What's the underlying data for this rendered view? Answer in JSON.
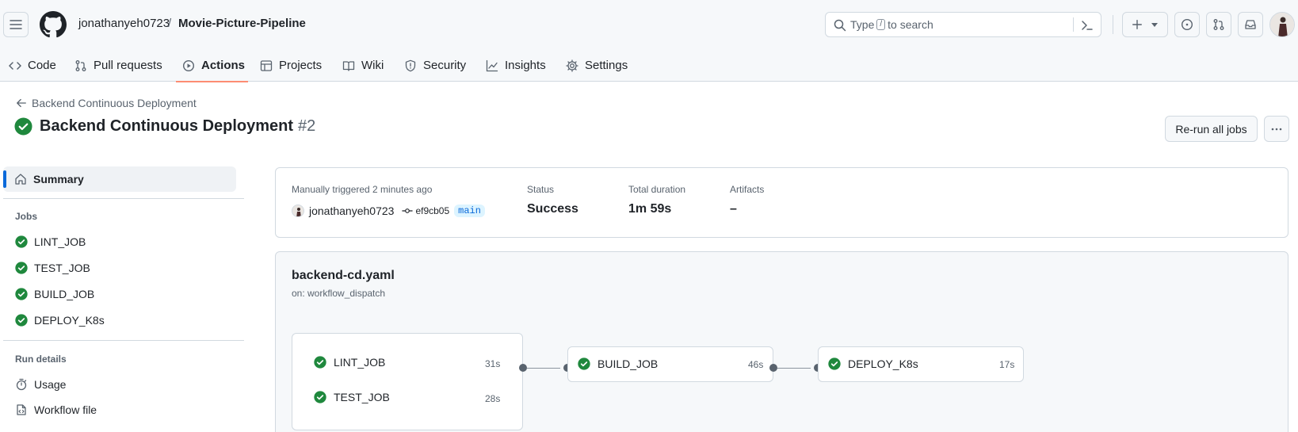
{
  "header": {
    "owner": "jonathanyeh0723",
    "separator": "/",
    "repo": "Movie-Picture-Pipeline",
    "search_prefix": "Type",
    "search_key": "/",
    "search_suffix": "to search"
  },
  "nav": [
    {
      "label": "Code",
      "icon": "code-icon"
    },
    {
      "label": "Pull requests",
      "icon": "git-pull-request-icon"
    },
    {
      "label": "Actions",
      "icon": "play-icon",
      "active": true
    },
    {
      "label": "Projects",
      "icon": "table-icon"
    },
    {
      "label": "Wiki",
      "icon": "book-icon"
    },
    {
      "label": "Security",
      "icon": "shield-icon"
    },
    {
      "label": "Insights",
      "icon": "graph-icon"
    },
    {
      "label": "Settings",
      "icon": "gear-icon"
    }
  ],
  "page": {
    "back_label": "Backend Continuous Deployment",
    "title": "Backend Continuous Deployment",
    "run_number": "#2",
    "rerun_label": "Re-run all jobs"
  },
  "sidebar": {
    "summary_label": "Summary",
    "jobs_heading": "Jobs",
    "jobs": [
      "LINT_JOB",
      "TEST_JOB",
      "BUILD_JOB",
      "DEPLOY_K8s"
    ],
    "run_details_heading": "Run details",
    "details": [
      {
        "label": "Usage",
        "icon": "stopwatch-icon"
      },
      {
        "label": "Workflow file",
        "icon": "file-code-icon"
      }
    ]
  },
  "summary": {
    "trigger_label": "Manually triggered 2 minutes ago",
    "actor": "jonathanyeh0723",
    "commit": "ef9cb05",
    "branch": "main",
    "status_label": "Status",
    "status_value": "Success",
    "duration_label": "Total duration",
    "duration_value": "1m 59s",
    "artifacts_label": "Artifacts",
    "artifacts_value": "–"
  },
  "workflow": {
    "file": "backend-cd.yaml",
    "trigger": "on: workflow_dispatch",
    "jobs": {
      "lint": {
        "name": "LINT_JOB",
        "duration": "31s"
      },
      "test": {
        "name": "TEST_JOB",
        "duration": "28s"
      },
      "build": {
        "name": "BUILD_JOB",
        "duration": "46s"
      },
      "deploy": {
        "name": "DEPLOY_K8s",
        "duration": "17s"
      }
    }
  },
  "colors": {
    "success": "#1f883d",
    "accent": "#0969da",
    "nav_underline": "#fd8c73"
  }
}
